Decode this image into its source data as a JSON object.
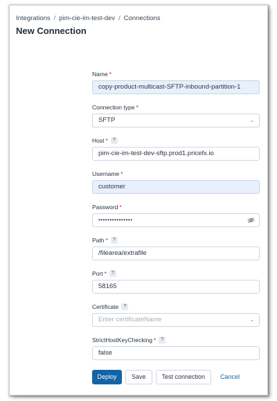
{
  "breadcrumb": {
    "items": [
      "Integrations",
      "pim-cie-im-test-dev",
      "Connections"
    ],
    "separator": "/"
  },
  "page_title": "New Connection",
  "form": {
    "name": {
      "label": "Name",
      "value": "copy-product-multicast-SFTP-inbound-partition-1"
    },
    "connection_type": {
      "label": "Connection type",
      "value": "SFTP"
    },
    "host": {
      "label": "Host",
      "help": "?",
      "value": "pim-cie-im-test-dev-sftp.prod1.pricefx.io"
    },
    "username": {
      "label": "Username",
      "value": "customer"
    },
    "password": {
      "label": "Password",
      "value": "•••••••••••••••"
    },
    "path": {
      "label": "Path",
      "help": "?",
      "value": "/filearea/extrafile"
    },
    "port": {
      "label": "Port",
      "help": "?",
      "value": "58165"
    },
    "certificate": {
      "label": "Certificate",
      "help": "?",
      "placeholder": "Enter certificateName"
    },
    "strict_host_key_checking": {
      "label": "StrictHostKeyChecking",
      "help": "?",
      "value": "false"
    },
    "required_marker": "*"
  },
  "actions": {
    "deploy": "Deploy",
    "save": "Save",
    "test_connection": "Test connection",
    "cancel": "Cancel"
  },
  "colors": {
    "primary": "#1364a7",
    "required": "#d4183d",
    "autofill": "#e8f0fe"
  },
  "icons": {
    "select": "chevron-down-icon",
    "password_toggle": "eye-off-icon"
  }
}
